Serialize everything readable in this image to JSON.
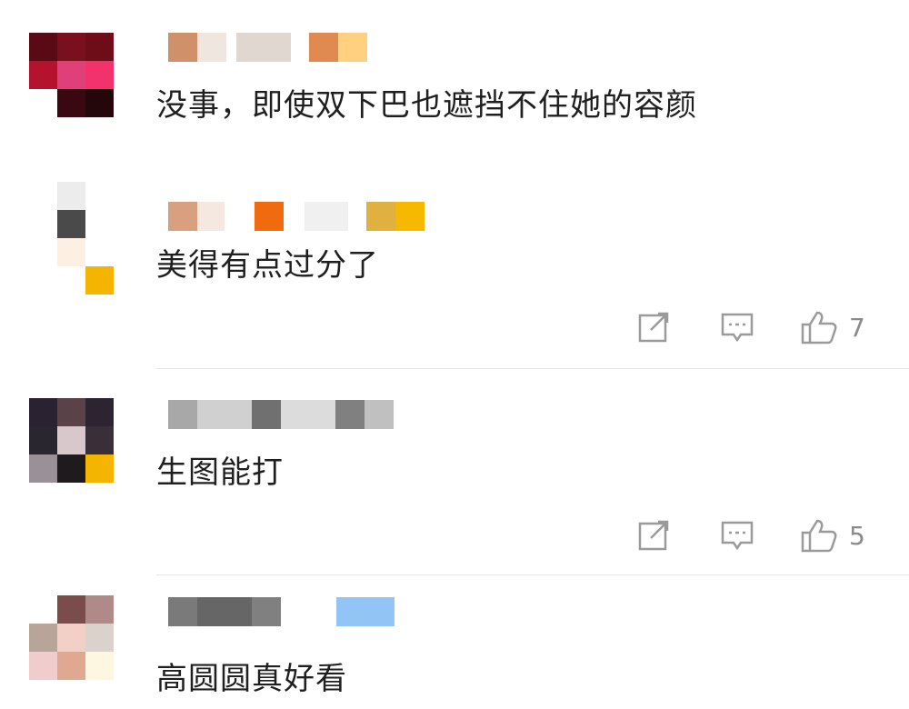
{
  "comments": [
    {
      "text": "没事，即使双下巴也遮挡不住她的容颜",
      "avatar_colors": [
        "#5a0a14",
        "#7a0f1e",
        "#6e0c18",
        "#b5122e",
        "#e0407a",
        "#f2326a",
        "#ffffff",
        "#3a0810",
        "#24070a"
      ],
      "name_colors": [
        "#d0906a",
        "#f0e6e0",
        "#e0d8d0",
        "#e08a52",
        "#ffd080"
      ]
    },
    {
      "text": "美得有点过分了",
      "avatar_colors": [
        "#ececec",
        "#4a4a4a",
        "#fdf0e2",
        "#f5b400"
      ],
      "name_colors": [
        "#d9a080",
        "#f4e8e0",
        "#f06a10",
        "#f0f0f0",
        "#e0b040",
        "#f7b800"
      ],
      "actions": {
        "share_icon": "share-icon",
        "reply_icon": "comment-icon",
        "like_icon": "thumbs-up-icon",
        "like_count": "7"
      }
    },
    {
      "text": "生图能打",
      "avatar_colors": [
        "#2a2230",
        "#5a4248",
        "#2c2430",
        "#2a2630",
        "#d8c8cc",
        "#3a2e38",
        "#9a9098",
        "#1e1a1e",
        "#f5b400"
      ],
      "name_colors": [
        "#a8a8a8",
        "#d0d0d0",
        "#707070",
        "#dcdcdc",
        "#808080",
        "#c0c0c0"
      ],
      "actions": {
        "share_icon": "share-icon",
        "reply_icon": "comment-icon",
        "like_icon": "thumbs-up-icon",
        "like_count": "5"
      }
    },
    {
      "text": "高圆圆真好看",
      "avatar_colors": [
        "#ffffff",
        "#7a4c4c",
        "#b08a88",
        "#b8a498",
        "#f2d0c8",
        "#dcd2cc",
        "#f0cccc",
        "#e0a890",
        "#fdf6e0"
      ],
      "name_colors": [
        "#7a7a7a",
        "#666666",
        "#808080",
        "#92c4f6"
      ]
    }
  ]
}
